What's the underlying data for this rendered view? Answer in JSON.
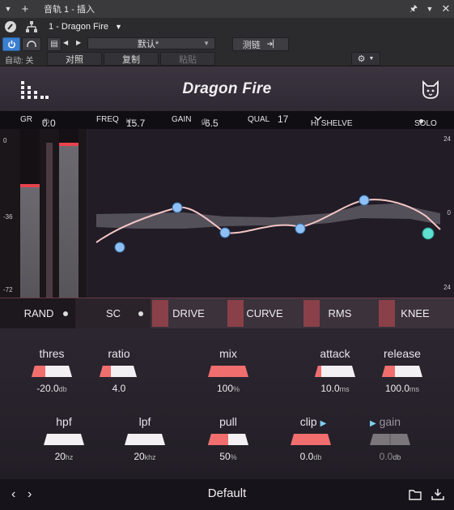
{
  "host": {
    "track_title": "音轨 1 - 插入",
    "plugin_select": "1 - Dragon Fire",
    "preset_label": "默认*",
    "sidechain_label": "测链",
    "auto_label": "自动: 关",
    "compare_label": "对照",
    "copy_label": "复制",
    "paste_label": "粘贴"
  },
  "plugin": {
    "title": "Dragon Fire"
  },
  "param_bar": {
    "gr_label": "GR",
    "gr_value": "0.0",
    "gr_unit": "db",
    "freq_label": "FREQ",
    "freq_value": "15.7",
    "freq_unit": "khz",
    "gain_label": "GAIN",
    "gain_value": "-6.5",
    "gain_unit": "db",
    "qual_label": "QUAL",
    "qual_value": "17",
    "filter_type": "HI SHELVE",
    "solo_label": "SOLO"
  },
  "meter": {
    "scale": [
      "0",
      "-36",
      "-72"
    ]
  },
  "eq": {
    "scale": [
      "24",
      "0",
      "24"
    ]
  },
  "modes": {
    "rand": "RAND",
    "sc": "SC",
    "drive": "DRIVE",
    "curve": "CURVE",
    "rms": "RMS",
    "knee": "KNEE"
  },
  "controls": {
    "thres": {
      "label": "thres",
      "value": "-20.0",
      "unit": "db"
    },
    "ratio": {
      "label": "ratio",
      "value": "4.0",
      "unit": ""
    },
    "mix": {
      "label": "mix",
      "value": "100",
      "unit": "%"
    },
    "attack": {
      "label": "attack",
      "value": "10.0",
      "unit": "ms"
    },
    "release": {
      "label": "release",
      "value": "100.0",
      "unit": "ms"
    },
    "hpf": {
      "label": "hpf",
      "value": "20",
      "unit": "hz"
    },
    "lpf": {
      "label": "lpf",
      "value": "20",
      "unit": "khz"
    },
    "pull": {
      "label": "pull",
      "value": "50",
      "unit": "%"
    },
    "clip": {
      "label": "clip",
      "value": "0.0",
      "unit": "db"
    },
    "gain": {
      "label": "gain",
      "value": "0.0",
      "unit": "db"
    }
  },
  "footer": {
    "preset_name": "Default"
  },
  "colors": {
    "accent": "#f06e6e",
    "node": "#8fc0f5",
    "node_active": "#5fe0d0"
  }
}
